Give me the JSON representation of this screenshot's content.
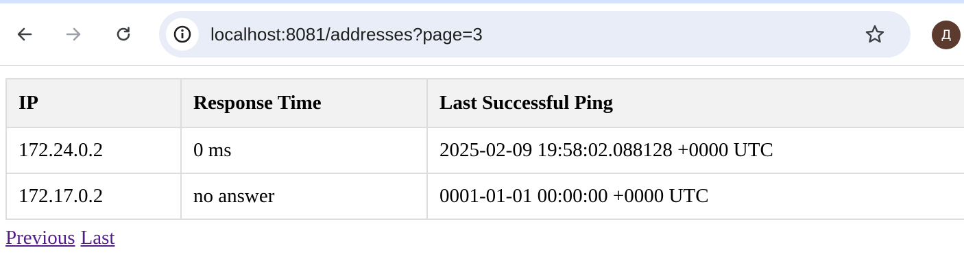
{
  "browser": {
    "url": "localhost:8081/addresses?page=3",
    "profile_initial": "Д",
    "icons": {
      "back": "arrow-left-icon",
      "forward": "arrow-right-icon",
      "reload": "reload-icon",
      "site_info": "info-icon",
      "bookmark": "star-icon"
    },
    "colors": {
      "omnibox_bg": "#e9edf7",
      "avatar_bg": "#5c3a2e",
      "header_bg": "#f2f2f2",
      "link_visited": "#551a8b"
    }
  },
  "table": {
    "headers": [
      "IP",
      "Response Time",
      "Last Successful Ping"
    ],
    "rows": [
      [
        "172.24.0.2",
        "0 ms",
        "2025-02-09 19:58:02.088128 +0000 UTC"
      ],
      [
        "172.17.0.2",
        "no answer",
        "0001-01-01 00:00:00 +0000 UTC"
      ]
    ]
  },
  "pager": {
    "previous_label": "Previous",
    "last_label": "Last"
  }
}
